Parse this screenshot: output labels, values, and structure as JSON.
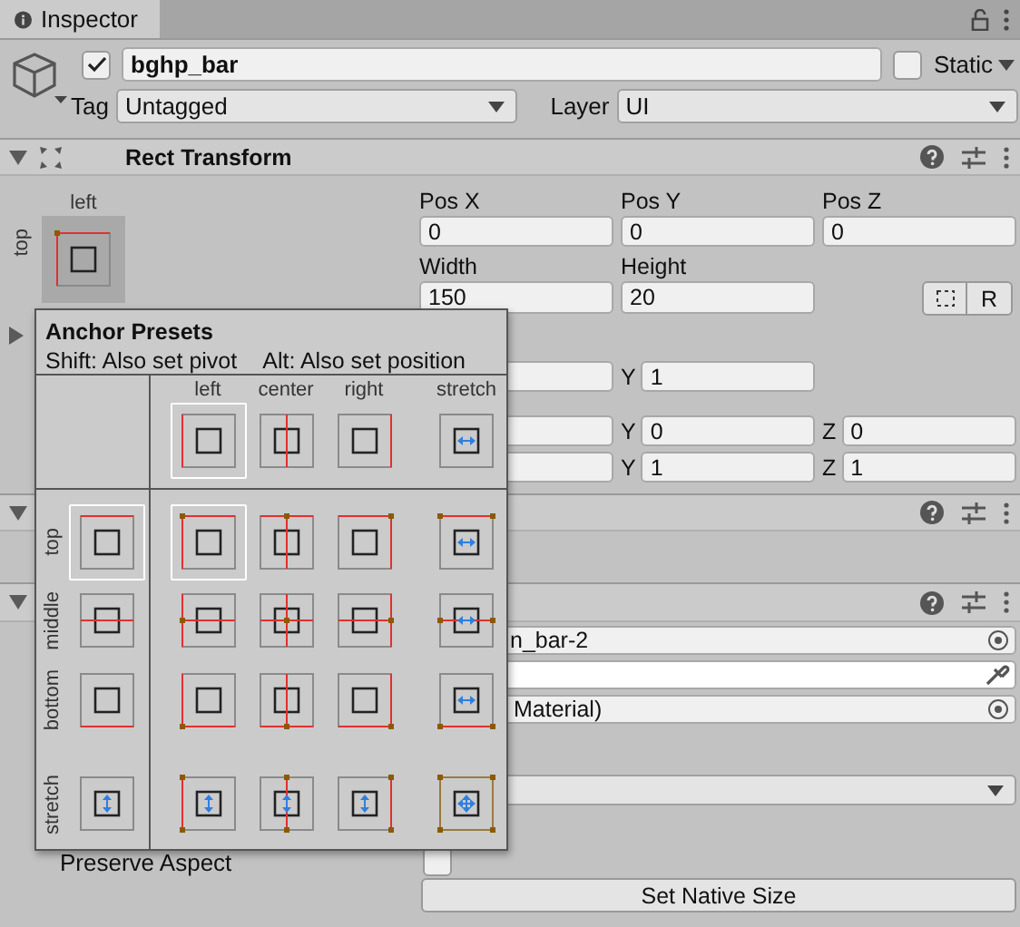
{
  "tab": {
    "label": "Inspector"
  },
  "object": {
    "active": true,
    "name": "bghp_bar",
    "static": false,
    "static_label": "Static",
    "tag_label": "Tag",
    "tag": "Untagged",
    "layer_label": "Layer",
    "layer": "UI"
  },
  "rect_transform": {
    "title": "Rect Transform",
    "expanded": true,
    "anchor_h_label": "left",
    "anchor_v_label": "top",
    "pos_labels": [
      "Pos X",
      "Pos Y",
      "Pos Z"
    ],
    "pos_values": [
      "0",
      "0",
      "0"
    ],
    "size_labels": [
      "Width",
      "Height"
    ],
    "size_values": [
      "150",
      "20"
    ],
    "raw_button": "R",
    "inner_foldout": {
      "expanded": false
    },
    "anchor_row": [
      {
        "axis": "Y",
        "value": "1"
      }
    ],
    "rotation": [
      {
        "axis": "Y",
        "value": "0"
      },
      {
        "axis": "Z",
        "value": "0"
      }
    ],
    "scale": [
      {
        "axis": "Y",
        "value": "1"
      },
      {
        "axis": "Z",
        "value": "1"
      }
    ]
  },
  "component_2": {
    "expanded": true
  },
  "component_3": {
    "expanded": true,
    "source": "n_bar-2",
    "color": "#ffffff",
    "material": "Material)",
    "preserve_aspect": {
      "label": "Preserve Aspect",
      "checked": false
    },
    "button": "Set Native Size"
  },
  "popup": {
    "title": "Anchor Presets",
    "hint_pivot": "Shift: Also set pivot",
    "hint_position": "Alt: Also set position",
    "columns": [
      {
        "label": "left",
        "selected": true
      },
      {
        "label": "center",
        "selected": false
      },
      {
        "label": "right",
        "selected": false
      },
      {
        "label": "stretch",
        "selected": false
      }
    ],
    "rows": [
      {
        "label": "top",
        "selected": true,
        "cells": [
          {
            "selected": true
          },
          {
            "selected": false
          },
          {
            "selected": false
          },
          {
            "selected": false
          }
        ]
      },
      {
        "label": "middle",
        "selected": false,
        "cells": [
          {
            "selected": false
          },
          {
            "selected": false
          },
          {
            "selected": false
          },
          {
            "selected": false
          }
        ]
      },
      {
        "label": "bottom",
        "selected": false,
        "cells": [
          {
            "selected": false
          },
          {
            "selected": false
          },
          {
            "selected": false
          },
          {
            "selected": false
          }
        ]
      },
      {
        "label": "stretch",
        "selected": false,
        "cells": [
          {
            "selected": false
          },
          {
            "selected": false
          },
          {
            "selected": false
          },
          {
            "selected": false
          }
        ]
      }
    ]
  }
}
